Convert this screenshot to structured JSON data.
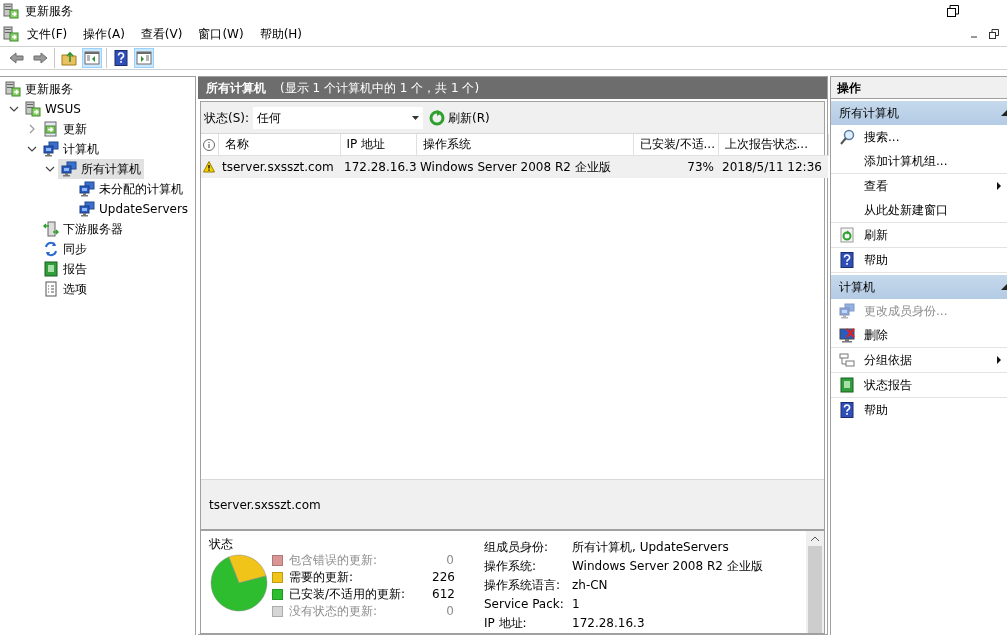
{
  "window": {
    "title": "更新服务"
  },
  "menu": [
    "文件(F)",
    "操作(A)",
    "查看(V)",
    "窗口(W)",
    "帮助(H)"
  ],
  "toolbar": [
    [
      {
        "kind": "back",
        "pressed": false
      },
      {
        "kind": "forward",
        "pressed": false
      }
    ],
    [
      {
        "kind": "up",
        "pressed": false
      },
      {
        "kind": "tree-pane",
        "pressed": true
      }
    ],
    [
      {
        "kind": "help",
        "pressed": false
      },
      {
        "kind": "action-pane",
        "pressed": true
      }
    ]
  ],
  "tree": [
    {
      "label": "更新服务",
      "kind": "root",
      "selected": false,
      "children": [
        {
          "label": "WSUS",
          "kind": "server",
          "selected": false,
          "expanded": true,
          "children": [
            {
              "label": "更新",
              "kind": "updates",
              "selected": false,
              "expanded": false
            },
            {
              "label": "计算机",
              "kind": "computers",
              "selected": false,
              "expanded": true,
              "children": [
                {
                  "label": "所有计算机",
                  "kind": "computers",
                  "selected": true,
                  "expanded": true,
                  "children": [
                    {
                      "label": "未分配的计算机",
                      "kind": "computers",
                      "selected": false
                    },
                    {
                      "label": "UpdateServers",
                      "kind": "computers",
                      "selected": false
                    }
                  ]
                }
              ]
            },
            {
              "label": "下游服务器",
              "kind": "downstream",
              "selected": false
            },
            {
              "label": "同步",
              "kind": "sync",
              "selected": false
            },
            {
              "label": "报告",
              "kind": "reports",
              "selected": false
            },
            {
              "label": "选项",
              "kind": "options",
              "selected": false
            }
          ]
        }
      ]
    }
  ],
  "content": {
    "header": {
      "title": "所有计算机",
      "subtitle": "(显示 1 个计算机中的 1 个，共 1 个)"
    },
    "filter": {
      "label": "状态(S):",
      "value": "任何"
    },
    "refresh": "刷新(R)",
    "table": {
      "columns": [
        "名称",
        "IP 地址",
        "操作系统",
        "已安装/不适...",
        "上次报告状态..."
      ],
      "rows": [
        {
          "selected": true,
          "warning": true,
          "cells": [
            "tserver.sxsszt.com",
            "172.28.16.3",
            "Windows Server 2008 R2 企业版",
            "73%",
            "2018/5/11 12:36"
          ]
        }
      ]
    },
    "detail": {
      "title": "tserver.sxsszt.com",
      "status": {
        "title": "状态",
        "legend": [
          {
            "label": "包含错误的更新:",
            "color": "#d99694",
            "count": "0"
          },
          {
            "label": "需要的更新:",
            "color": "#f0c419",
            "count": "226"
          },
          {
            "label": "已安装/不适用的更新:",
            "color": "#2ebd2e",
            "count": "612"
          },
          {
            "label": "没有状态的更新:",
            "color": "#d6d6d6",
            "count": "0"
          }
        ]
      },
      "properties": [
        {
          "label": "组成员身份:",
          "value": "所有计算机, UpdateServers"
        },
        {
          "label": "操作系统:",
          "value": "Windows Server 2008 R2 企业版"
        },
        {
          "label": "操作系统语言:",
          "value": "zh-CN"
        },
        {
          "label": "Service Pack:",
          "value": "1"
        },
        {
          "label": "IP 地址:",
          "value": "172.28.16.3"
        }
      ]
    }
  },
  "actions": {
    "title": "操作",
    "sections": [
      {
        "title": "所有计算机",
        "expanded": true,
        "groups": [
          [
            {
              "label": "搜索...",
              "kind": "search",
              "disabled": false,
              "submenu": false
            },
            {
              "label": "添加计算机组...",
              "kind": "plain",
              "disabled": false,
              "submenu": false
            }
          ],
          [
            {
              "label": "查看",
              "kind": "plain",
              "disabled": false,
              "submenu": true
            },
            {
              "label": "从此处新建窗口",
              "kind": "plain",
              "disabled": false,
              "submenu": false
            }
          ],
          [
            {
              "label": "刷新",
              "kind": "refresh",
              "disabled": false,
              "submenu": false
            }
          ],
          [
            {
              "label": "帮助",
              "kind": "help",
              "disabled": false,
              "submenu": false
            }
          ]
        ]
      },
      {
        "title": "计算机",
        "expanded": true,
        "groups": [
          [
            {
              "label": "更改成员身份...",
              "kind": "membership",
              "disabled": true,
              "submenu": false
            },
            {
              "label": "删除",
              "kind": "delete",
              "disabled": false,
              "submenu": false
            }
          ],
          [
            {
              "label": "分组依据",
              "kind": "group",
              "disabled": false,
              "submenu": true
            }
          ],
          [
            {
              "label": "状态报告",
              "kind": "report",
              "disabled": false,
              "submenu": false
            }
          ],
          [
            {
              "label": "帮助",
              "kind": "help",
              "disabled": false,
              "submenu": false
            }
          ]
        ]
      }
    ]
  }
}
